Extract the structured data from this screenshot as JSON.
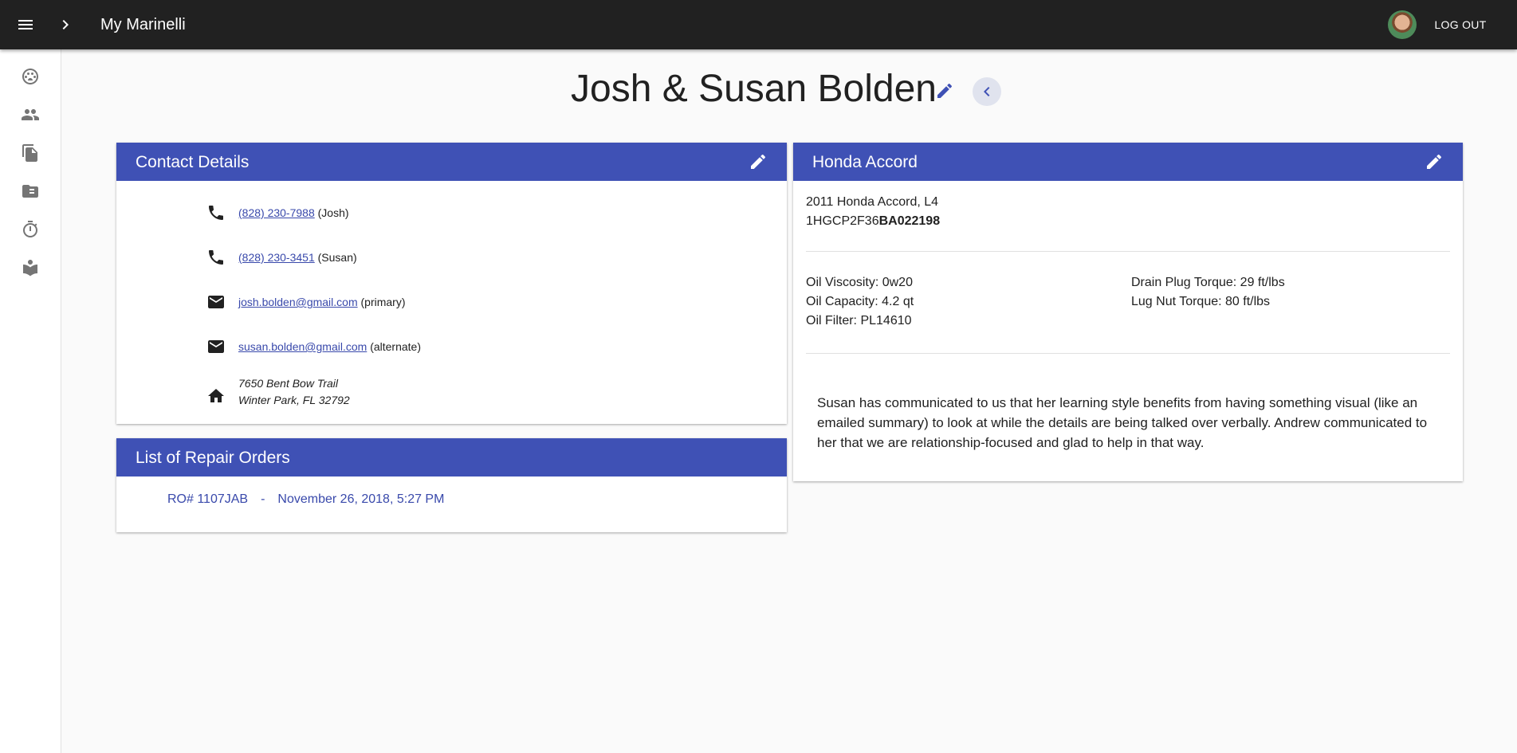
{
  "app": {
    "title": "My Marinelli",
    "logout_label": "LOG OUT",
    "accent_color": "#3f51b5",
    "link_color": "#3949ab",
    "bar_color": "#212121"
  },
  "sidebar": {
    "items": [
      {
        "name": "dashboard-icon"
      },
      {
        "name": "customers-icon"
      },
      {
        "name": "documents-icon"
      },
      {
        "name": "labels-icon"
      },
      {
        "name": "timer-icon"
      },
      {
        "name": "learning-icon"
      }
    ]
  },
  "customer": {
    "name": "Josh & Susan Bolden"
  },
  "contact": {
    "header": "Contact Details",
    "phones": [
      {
        "number": "(828) 230-7988",
        "label": "(Josh)"
      },
      {
        "number": "(828) 230-3451",
        "label": "(Susan)"
      }
    ],
    "emails": [
      {
        "address": "josh.bolden@gmail.com",
        "label": "(primary)"
      },
      {
        "address": "susan.bolden@gmail.com",
        "label": "(alternate)"
      }
    ],
    "address": {
      "line1": "7650 Bent Bow Trail",
      "line2": "Winter Park, FL 32792"
    }
  },
  "repair_orders": {
    "header": "List of Repair Orders",
    "items": [
      {
        "ro": "RO# 1107JAB",
        "separator": "-",
        "date": "November 26, 2018, 5:27 PM"
      }
    ]
  },
  "vehicle": {
    "header": "Honda Accord",
    "description": "2011 Honda Accord, L4",
    "vin_prefix": "1HGCP2F36",
    "vin_suffix": "BA022198",
    "specs_left": [
      "Oil Viscosity: 0w20",
      "Oil Capacity: 4.2 qt",
      "Oil Filter: PL14610"
    ],
    "specs_right": [
      "Drain Plug Torque: 29 ft/lbs",
      "Lug Nut Torque: 80 ft/lbs"
    ],
    "note": "Susan has communicated to us that her learning style benefits from having something visual (like an emailed summary) to look at while the details are being talked over verbally. Andrew communicated to her that we are relationship-focused and glad to help in that way."
  }
}
